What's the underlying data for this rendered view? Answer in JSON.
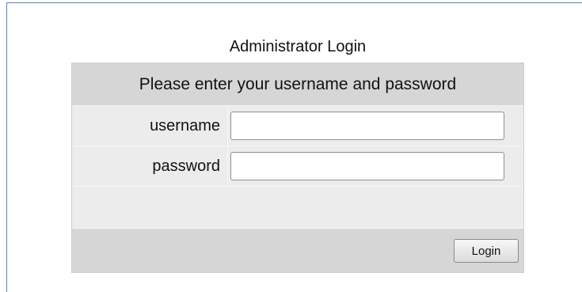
{
  "login": {
    "title": "Administrator Login",
    "prompt": "Please enter your username and password",
    "username_label": "username",
    "username_value": "",
    "password_label": "password",
    "password_value": "",
    "login_label": "Login"
  },
  "colors": {
    "frame": "#5b86c0",
    "header_bg": "#d6d6d6",
    "row_bg": "#ececec"
  }
}
